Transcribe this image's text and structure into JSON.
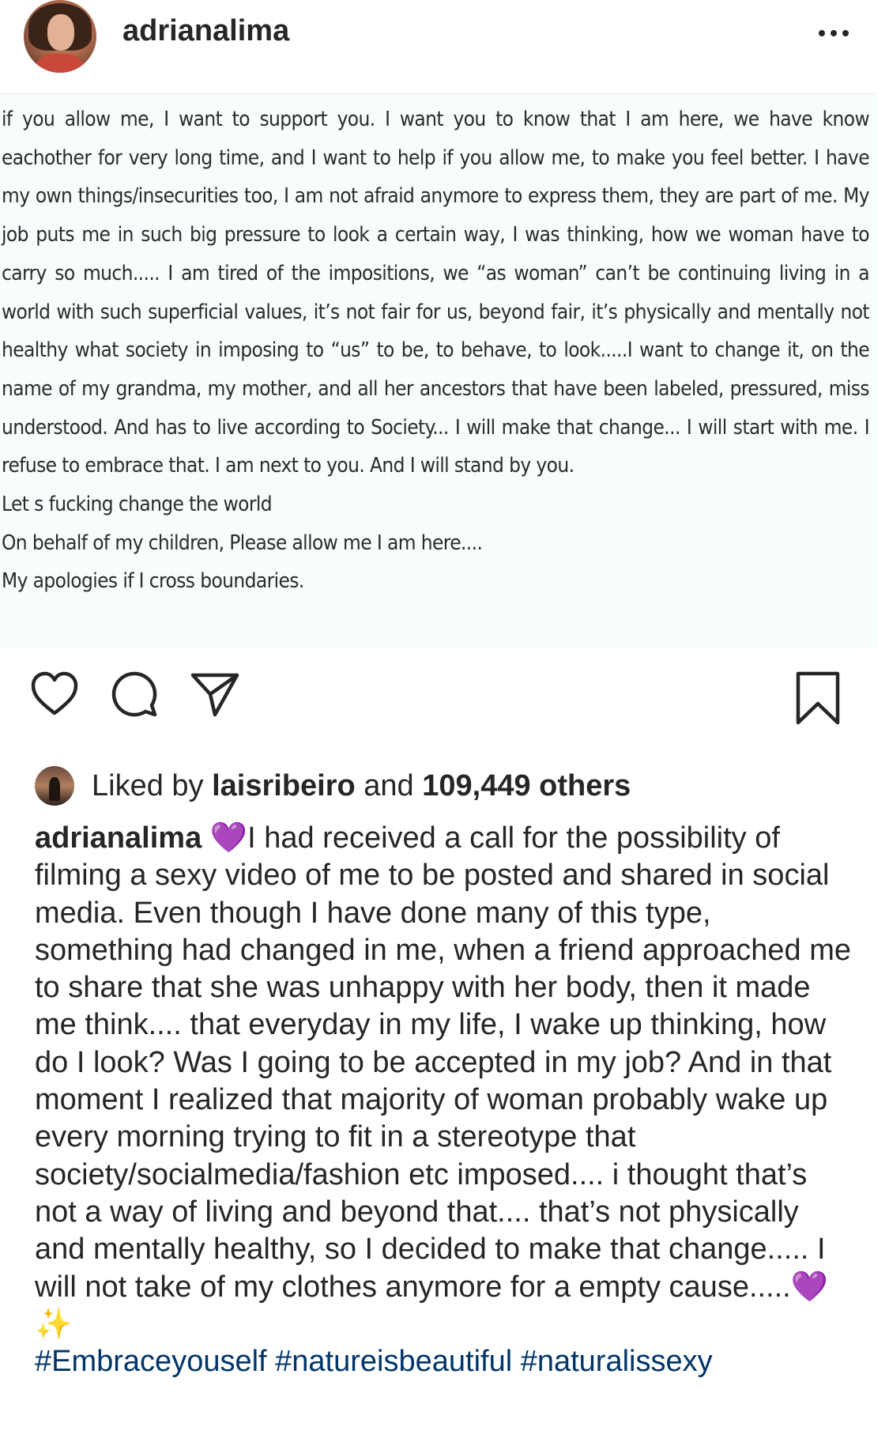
{
  "header": {
    "username": "adrianalima",
    "avatar_icon": "profile-photo",
    "more_icon": "ellipsis-icon"
  },
  "post_image": {
    "lines": [
      "if you allow me, I want to support you. I want you to know that I am here, we have know eachother for very long time, and I want to help if you allow me, to make you feel better. I have my own things/insecurities too, I am not afraid anymore to express them, they are part of me. My job puts me in such big pressure to look a certain way, I was thinking, how we woman have to carry so much..... I am tired of the impositions, we “as woman” can’t be continuing living in a world with such superficial values, it’s not fair for us, beyond fair, it’s physically and mentally not healthy what society in imposing to “us” to be, to behave, to look.....I want to change it, on the name of my grandma, my mother, and all her ancestors that have been labeled, pressured, miss understood. And has to live according to Society... I will make that change... I will start with me. I refuse to embrace that. I am next to you. And I will stand by you.",
      "Let s fucking change the world",
      "On behalf of my children, Please allow me I am here....",
      "My apologies if I cross boundaries."
    ]
  },
  "actions": {
    "like_icon": "heart-icon",
    "comment_icon": "comment-bubble-icon",
    "share_icon": "paper-plane-icon",
    "save_icon": "bookmark-icon"
  },
  "likes": {
    "prefix": "Liked by ",
    "user": "laisribeiro",
    "middle": " and ",
    "count": "109,449 others"
  },
  "caption": {
    "username": "adrianalima",
    "emoji_heart": "💜",
    "text": "I had received a call for the possibility of filming a sexy video of me to be posted and shared in social media. Even though I have done many of this type, something had changed in me, when a friend approached me to share that she was unhappy with her body, then it made me think.... that everyday in my life, I wake up thinking, how do I look? Was I going to be accepted in my job? And in that moment I realized that majority of woman probably wake up every morning trying to fit in a stereotype that society/socialmedia/fashion etc imposed.... i thought that’s not a way of living and beyond that.... that’s not physically and mentally healthy, so I decided to make that change..... I will not take of my clothes anymore for a empty cause.....",
    "emoji_end_heart": "💜",
    "emoji_sparkles": "✨",
    "hashtags": [
      "#Embraceyouself",
      "#natureisbeautiful",
      "#naturalissexy"
    ]
  },
  "colors": {
    "text": "#262626",
    "hashtag": "#003569",
    "post_background": "#f7fcfc",
    "heart_emoji": "#9b3fdc"
  }
}
